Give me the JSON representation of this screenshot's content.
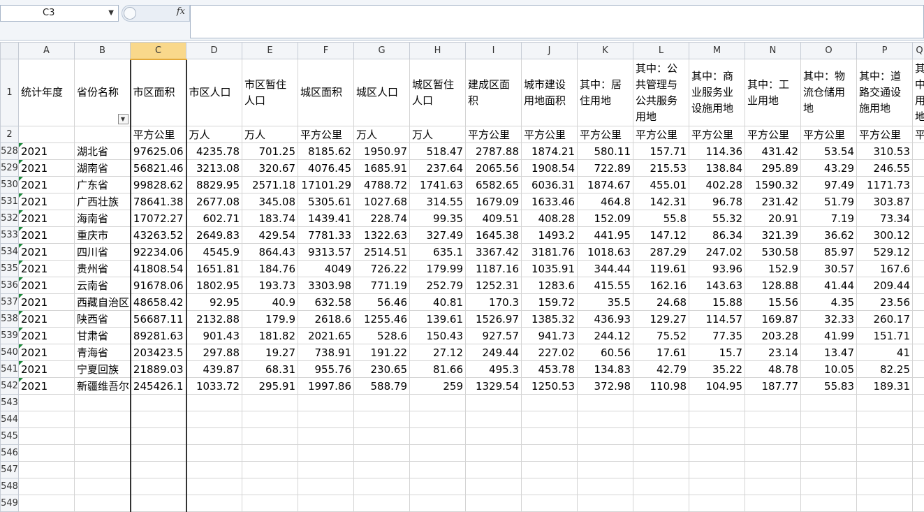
{
  "formula_bar": {
    "cell_ref": "C3",
    "fx_label": "fx",
    "formula": ""
  },
  "columns": [
    "A",
    "B",
    "C",
    "D",
    "E",
    "F",
    "G",
    "H",
    "I",
    "J",
    "K",
    "L",
    "M",
    "N",
    "O",
    "P"
  ],
  "selected_column": "C",
  "header_row_num": "1",
  "unit_row_num": "2",
  "headers": [
    "统计年度",
    "省份名称",
    "市区面积",
    "市区人口",
    "市区暂住人口",
    "城区面积",
    "城区人口",
    "城区暂住人口",
    "建成区面积",
    "城市建设用地面积",
    "其中：居住用地",
    "其中：公共管理与公共服务用地",
    "其中：商业服务业设施用地",
    "其中：工业用地",
    "其中：物流仓储用地",
    "其中：道路交通设施用地"
  ],
  "header_partial_Q": "其中：用地",
  "units": [
    "",
    "",
    "平方公里",
    "万人",
    "万人",
    "平方公里",
    "万人",
    "万人",
    "平方公里",
    "平方公里",
    "平方公里",
    "平方公里",
    "平方公里",
    "平方公里",
    "平方公里",
    "平方公里"
  ],
  "unit_partial_Q": "平",
  "rows": [
    {
      "n": "528",
      "c": [
        "2021",
        "湖北省",
        "97625.06",
        "4235.78",
        "701.25",
        "8185.62",
        "1950.97",
        "518.47",
        "2787.88",
        "1874.21",
        "580.11",
        "157.71",
        "114.36",
        "431.42",
        "53.54",
        "310.53"
      ]
    },
    {
      "n": "529",
      "c": [
        "2021",
        "湖南省",
        "56821.46",
        "3213.08",
        "320.67",
        "4076.45",
        "1685.91",
        "237.64",
        "2065.56",
        "1908.54",
        "722.89",
        "215.53",
        "138.84",
        "295.89",
        "43.29",
        "246.55"
      ]
    },
    {
      "n": "530",
      "c": [
        "2021",
        "广东省",
        "99828.62",
        "8829.95",
        "2571.18",
        "17101.29",
        "4788.72",
        "1741.63",
        "6582.65",
        "6036.31",
        "1874.67",
        "455.01",
        "402.28",
        "1590.32",
        "97.49",
        "1171.73"
      ]
    },
    {
      "n": "531",
      "c": [
        "2021",
        "广西壮族",
        "78641.38",
        "2677.08",
        "345.08",
        "5305.61",
        "1027.68",
        "314.55",
        "1679.09",
        "1633.46",
        "464.8",
        "142.31",
        "96.78",
        "231.42",
        "51.79",
        "303.87"
      ]
    },
    {
      "n": "532",
      "c": [
        "2021",
        "海南省",
        "17072.27",
        "602.71",
        "183.74",
        "1439.41",
        "228.74",
        "99.35",
        "409.51",
        "408.28",
        "152.09",
        "55.8",
        "55.32",
        "20.91",
        "7.19",
        "73.34"
      ]
    },
    {
      "n": "533",
      "c": [
        "2021",
        "重庆市",
        "43263.52",
        "2649.83",
        "429.54",
        "7781.33",
        "1322.63",
        "327.49",
        "1645.38",
        "1493.2",
        "441.95",
        "147.12",
        "86.34",
        "321.39",
        "36.62",
        "300.12"
      ]
    },
    {
      "n": "534",
      "c": [
        "2021",
        "四川省",
        "92234.06",
        "4545.9",
        "864.43",
        "9313.57",
        "2514.51",
        "635.1",
        "3367.42",
        "3181.76",
        "1018.63",
        "287.29",
        "247.02",
        "530.58",
        "85.97",
        "529.12"
      ]
    },
    {
      "n": "535",
      "c": [
        "2021",
        "贵州省",
        "41808.54",
        "1651.81",
        "184.76",
        "4049",
        "726.22",
        "179.99",
        "1187.16",
        "1035.91",
        "344.44",
        "119.61",
        "93.96",
        "152.9",
        "30.57",
        "167.6"
      ]
    },
    {
      "n": "536",
      "c": [
        "2021",
        "云南省",
        "91678.06",
        "1802.95",
        "193.73",
        "3303.98",
        "771.19",
        "252.79",
        "1252.31",
        "1283.6",
        "415.55",
        "162.16",
        "143.63",
        "128.88",
        "41.44",
        "209.44"
      ]
    },
    {
      "n": "537",
      "c": [
        "2021",
        "西藏自治区",
        "48658.42",
        "92.95",
        "40.9",
        "632.58",
        "56.46",
        "40.81",
        "170.3",
        "159.72",
        "35.5",
        "24.68",
        "15.88",
        "15.56",
        "4.35",
        "23.56"
      ]
    },
    {
      "n": "538",
      "c": [
        "2021",
        "陕西省",
        "56687.11",
        "2132.88",
        "179.9",
        "2618.6",
        "1255.46",
        "139.61",
        "1526.97",
        "1385.32",
        "436.93",
        "129.27",
        "114.57",
        "169.87",
        "32.33",
        "260.17"
      ]
    },
    {
      "n": "539",
      "c": [
        "2021",
        "甘肃省",
        "89281.63",
        "901.43",
        "181.82",
        "2021.65",
        "528.6",
        "150.43",
        "927.57",
        "941.73",
        "244.12",
        "75.52",
        "77.35",
        "203.28",
        "41.99",
        "151.71"
      ]
    },
    {
      "n": "540",
      "c": [
        "2021",
        "青海省",
        "203423.5",
        "297.88",
        "19.27",
        "738.91",
        "191.22",
        "27.12",
        "249.44",
        "227.02",
        "60.56",
        "17.61",
        "15.7",
        "23.14",
        "13.47",
        "41"
      ]
    },
    {
      "n": "541",
      "c": [
        "2021",
        "宁夏回族",
        "21889.03",
        "439.87",
        "68.31",
        "955.76",
        "230.65",
        "81.66",
        "495.3",
        "453.78",
        "134.83",
        "42.79",
        "35.22",
        "48.78",
        "10.05",
        "82.25"
      ]
    },
    {
      "n": "542",
      "c": [
        "2021",
        "新疆维吾尔",
        "245426.1",
        "1033.72",
        "295.91",
        "1997.86",
        "588.79",
        "259",
        "1329.54",
        "1250.53",
        "372.98",
        "110.98",
        "104.95",
        "187.77",
        "55.83",
        "189.31"
      ]
    }
  ],
  "empty_rows": [
    "543",
    "544",
    "545",
    "546",
    "547",
    "548",
    "549"
  ]
}
